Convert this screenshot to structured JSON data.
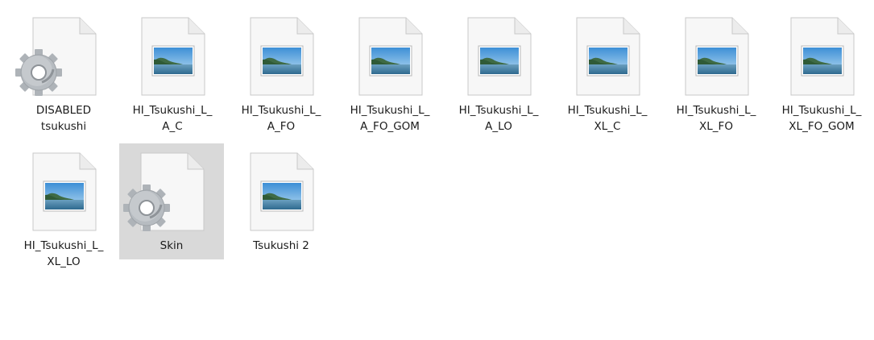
{
  "files": [
    {
      "name": "DISABLED\ntsukushi",
      "icon": "settings-file-icon",
      "selected": false
    },
    {
      "name": "HI_Tsukushi_L_\nA_C",
      "icon": "image-file-icon",
      "selected": false
    },
    {
      "name": "HI_Tsukushi_L_\nA_FO",
      "icon": "image-file-icon",
      "selected": false
    },
    {
      "name": "HI_Tsukushi_L_\nA_FO_GOM",
      "icon": "image-file-icon",
      "selected": false
    },
    {
      "name": "HI_Tsukushi_L_\nA_LO",
      "icon": "image-file-icon",
      "selected": false
    },
    {
      "name": "HI_Tsukushi_L_\nXL_C",
      "icon": "image-file-icon",
      "selected": false
    },
    {
      "name": "HI_Tsukushi_L_\nXL_FO",
      "icon": "image-file-icon",
      "selected": false
    },
    {
      "name": "HI_Tsukushi_L_\nXL_FO_GOM",
      "icon": "image-file-icon",
      "selected": false
    },
    {
      "name": "HI_Tsukushi_L_\nXL_LO",
      "icon": "image-file-icon",
      "selected": false
    },
    {
      "name": "Skin",
      "icon": "settings-file-icon",
      "selected": true
    },
    {
      "name": "Tsukushi 2",
      "icon": "image-file-icon",
      "selected": false
    }
  ],
  "colors": {
    "selection_background": "#d9d9d9",
    "label_text": "#1b1b1b"
  }
}
